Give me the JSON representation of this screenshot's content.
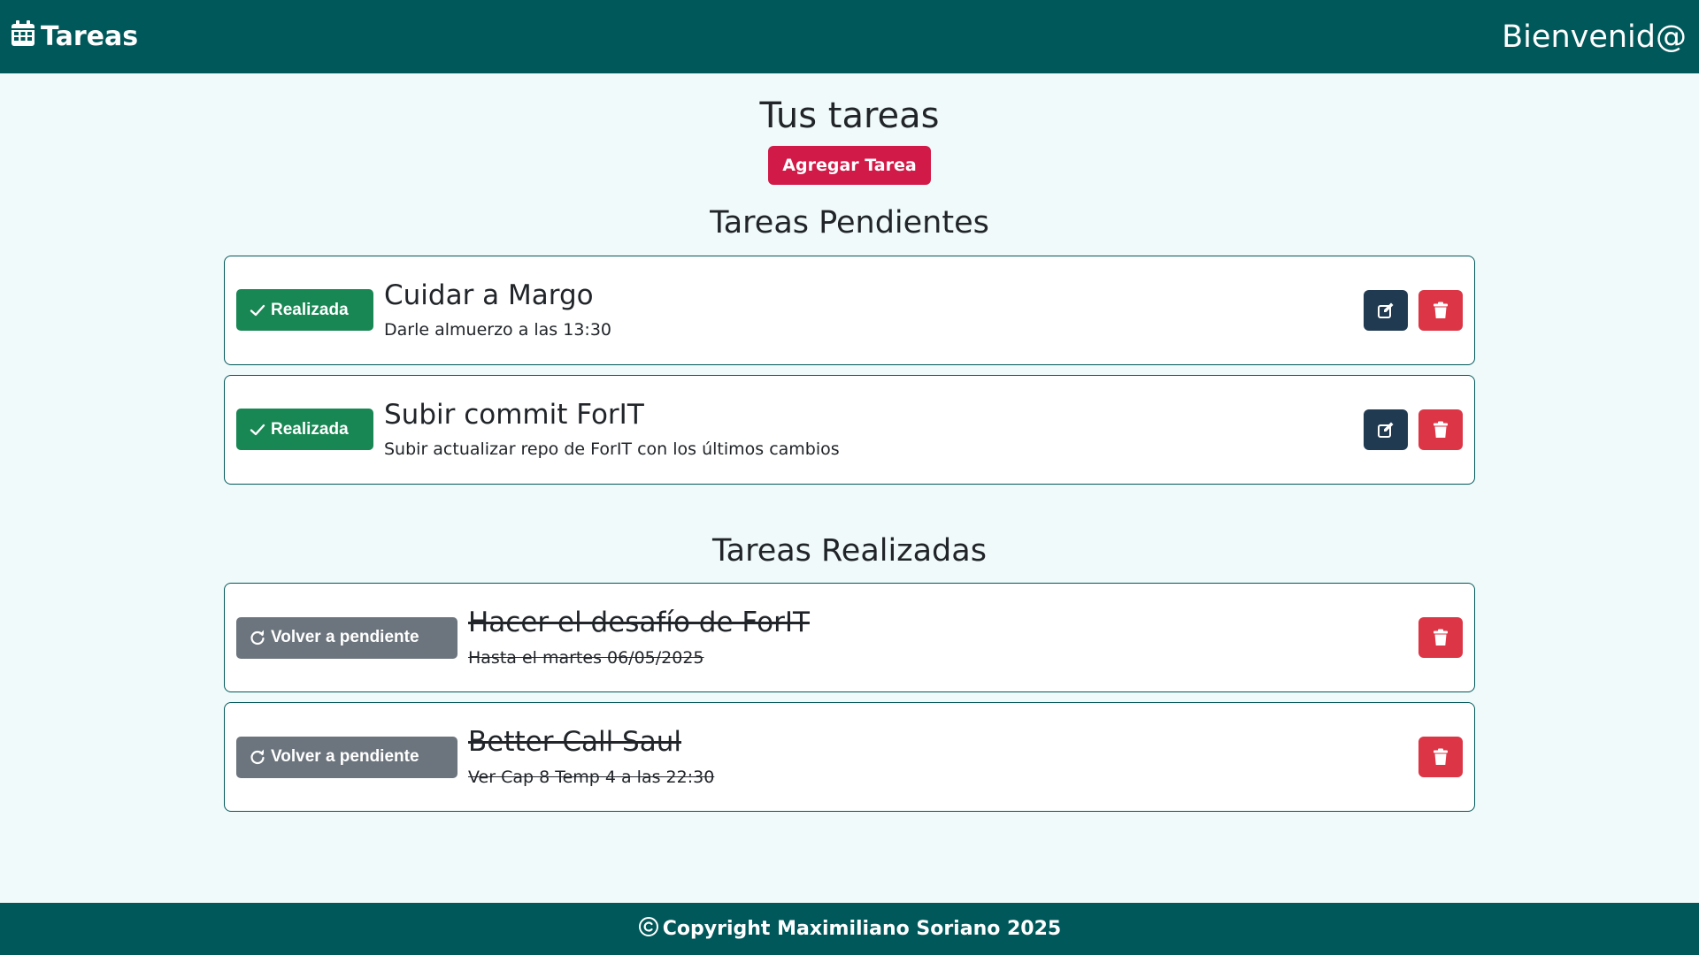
{
  "navbar": {
    "brand_label": "Tareas",
    "brand_icon": "calendar-icon",
    "welcome": "Bienvenid@"
  },
  "main": {
    "title": "Tus tareas",
    "add_button": "Agregar Tarea",
    "pending_title": "Tareas Pendientes",
    "done_title": "Tareas Realizadas"
  },
  "pending": [
    {
      "title": "Cuidar a Margo",
      "description": "Darle almuerzo a las 13:30",
      "status_button": "Realizada"
    },
    {
      "title": "Subir commit ForIT",
      "description": "Subir actualizar repo de ForIT con los últimos cambios",
      "status_button": "Realizada"
    }
  ],
  "done": [
    {
      "title": "Hacer el desafío de ForIT",
      "description": "Hasta el martes 06/05/2025",
      "status_button": "Volver a pendiente"
    },
    {
      "title": "Better Call Saul",
      "description": "Ver Cap 8 Temp 4 a las 22:30",
      "status_button": "Volver a pendiente"
    }
  ],
  "footer": {
    "text": "Copyright Maximiliano Soriano 2025",
    "icon": "copyright-icon"
  },
  "colors": {
    "primary": "#00585a",
    "background": "#f0fafa",
    "add_button": "#d11a48",
    "success": "#198754",
    "secondary": "#6c757d",
    "edit": "#203a52",
    "danger": "#dc3545"
  }
}
